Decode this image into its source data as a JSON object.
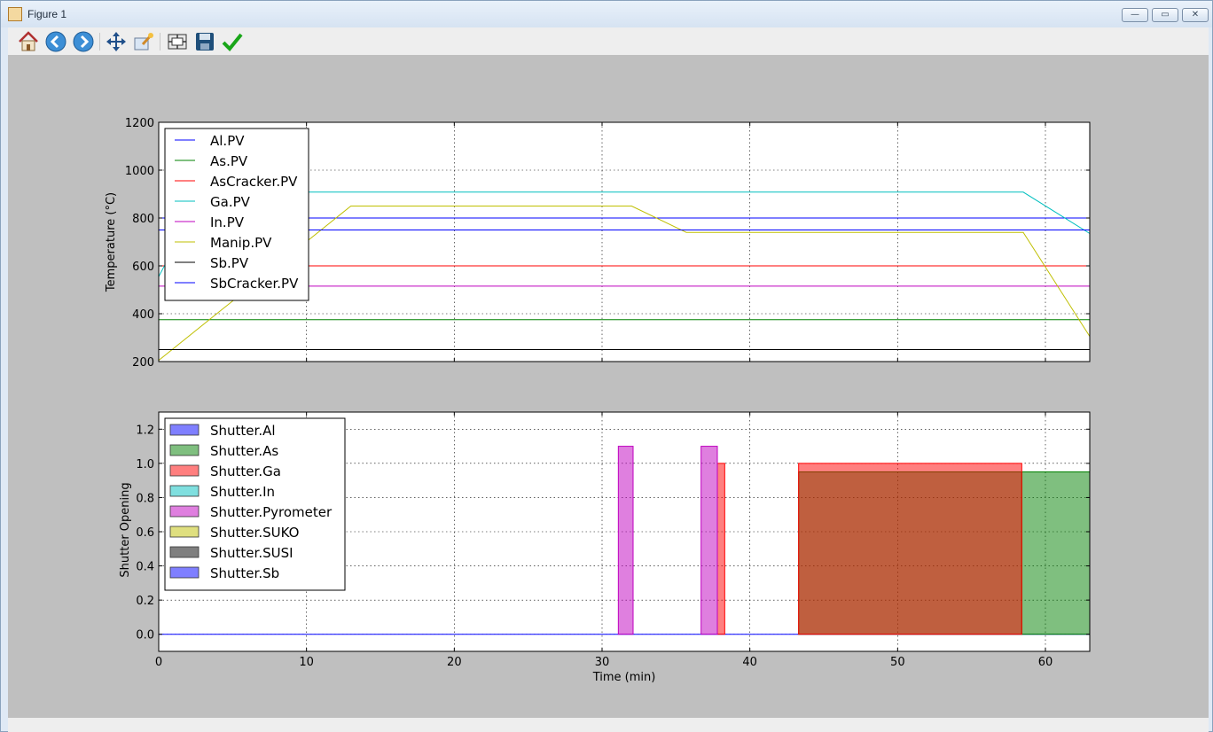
{
  "window": {
    "title": "Figure 1"
  },
  "toolbar": [
    {
      "icon": "home-icon"
    },
    {
      "icon": "back-icon"
    },
    {
      "icon": "forward-icon"
    },
    {
      "icon": "pan-icon"
    },
    {
      "icon": "zoom-icon"
    },
    {
      "icon": "configure-subplots-icon"
    },
    {
      "icon": "save-icon"
    },
    {
      "icon": "edit-parameters-icon"
    }
  ],
  "chart_data": [
    {
      "type": "line",
      "ylabel": "Temperature (°C)",
      "xlim": [
        0,
        63
      ],
      "ylim": [
        200,
        1200
      ],
      "xticks": [
        0,
        10,
        20,
        30,
        40,
        50,
        60
      ],
      "yticks": [
        200,
        400,
        600,
        800,
        1000,
        1200
      ],
      "grid": true,
      "legend_position": "upper-left",
      "series": [
        {
          "name": "Al.PV",
          "color": "#0000ff",
          "points": [
            [
              0,
              800
            ],
            [
              63,
              800
            ]
          ]
        },
        {
          "name": "As.PV",
          "color": "#008000",
          "points": [
            [
              0,
              375
            ],
            [
              63,
              375
            ]
          ]
        },
        {
          "name": "AsCracker.PV",
          "color": "#ff0000",
          "points": [
            [
              0,
              600
            ],
            [
              63,
              600
            ]
          ]
        },
        {
          "name": "Ga.PV",
          "color": "#00bfbf",
          "points": [
            [
              0,
              555
            ],
            [
              3,
              908
            ],
            [
              58.5,
              908
            ],
            [
              63,
              735
            ]
          ]
        },
        {
          "name": "In.PV",
          "color": "#bf00bf",
          "points": [
            [
              0,
              515
            ],
            [
              63,
              515
            ]
          ]
        },
        {
          "name": "Manip.PV",
          "color": "#bfbf00",
          "points": [
            [
              0,
              205
            ],
            [
              13,
              850
            ],
            [
              32,
              850
            ],
            [
              35.7,
              740
            ],
            [
              58.5,
              740
            ],
            [
              63,
              305
            ]
          ]
        },
        {
          "name": "Sb.PV",
          "color": "#000000",
          "points": [
            [
              0,
              250
            ],
            [
              63,
              250
            ]
          ]
        },
        {
          "name": "SbCracker.PV",
          "color": "#0000ff",
          "points": [
            [
              0,
              750
            ],
            [
              63,
              750
            ]
          ]
        }
      ]
    },
    {
      "type": "area",
      "xlabel": "Time (min)",
      "ylabel": "Shutter Opening",
      "xlim": [
        0,
        63
      ],
      "ylim": [
        -0.1,
        1.3
      ],
      "xticks": [
        0,
        10,
        20,
        30,
        40,
        50,
        60
      ],
      "yticks": [
        0.0,
        0.2,
        0.4,
        0.6,
        0.8,
        1.0,
        1.2
      ],
      "grid": true,
      "legend_position": "upper-left",
      "series": [
        {
          "name": "Shutter.Al",
          "color": "#0000ff",
          "segments": []
        },
        {
          "name": "Shutter.As",
          "color": "#008000",
          "segments": [
            [
              43.3,
              58.4,
              0.95
            ],
            [
              58.4,
              63,
              0.95
            ]
          ]
        },
        {
          "name": "Shutter.Ga",
          "color": "#ff0000",
          "segments": [
            [
              37.8,
              38.3,
              1.0
            ],
            [
              43.3,
              58.4,
              1.0
            ]
          ]
        },
        {
          "name": "Shutter.In",
          "color": "#00bfbf",
          "segments": []
        },
        {
          "name": "Shutter.Pyrometer",
          "color": "#bf00bf",
          "segments": [
            [
              31.1,
              32.1,
              1.1
            ],
            [
              36.7,
              37.8,
              1.1
            ]
          ]
        },
        {
          "name": "Shutter.SUKO",
          "color": "#bfbf00",
          "segments": []
        },
        {
          "name": "Shutter.SUSI",
          "color": "#000000",
          "segments": []
        },
        {
          "name": "Shutter.Sb",
          "color": "#0000ff",
          "segments": []
        }
      ]
    }
  ]
}
